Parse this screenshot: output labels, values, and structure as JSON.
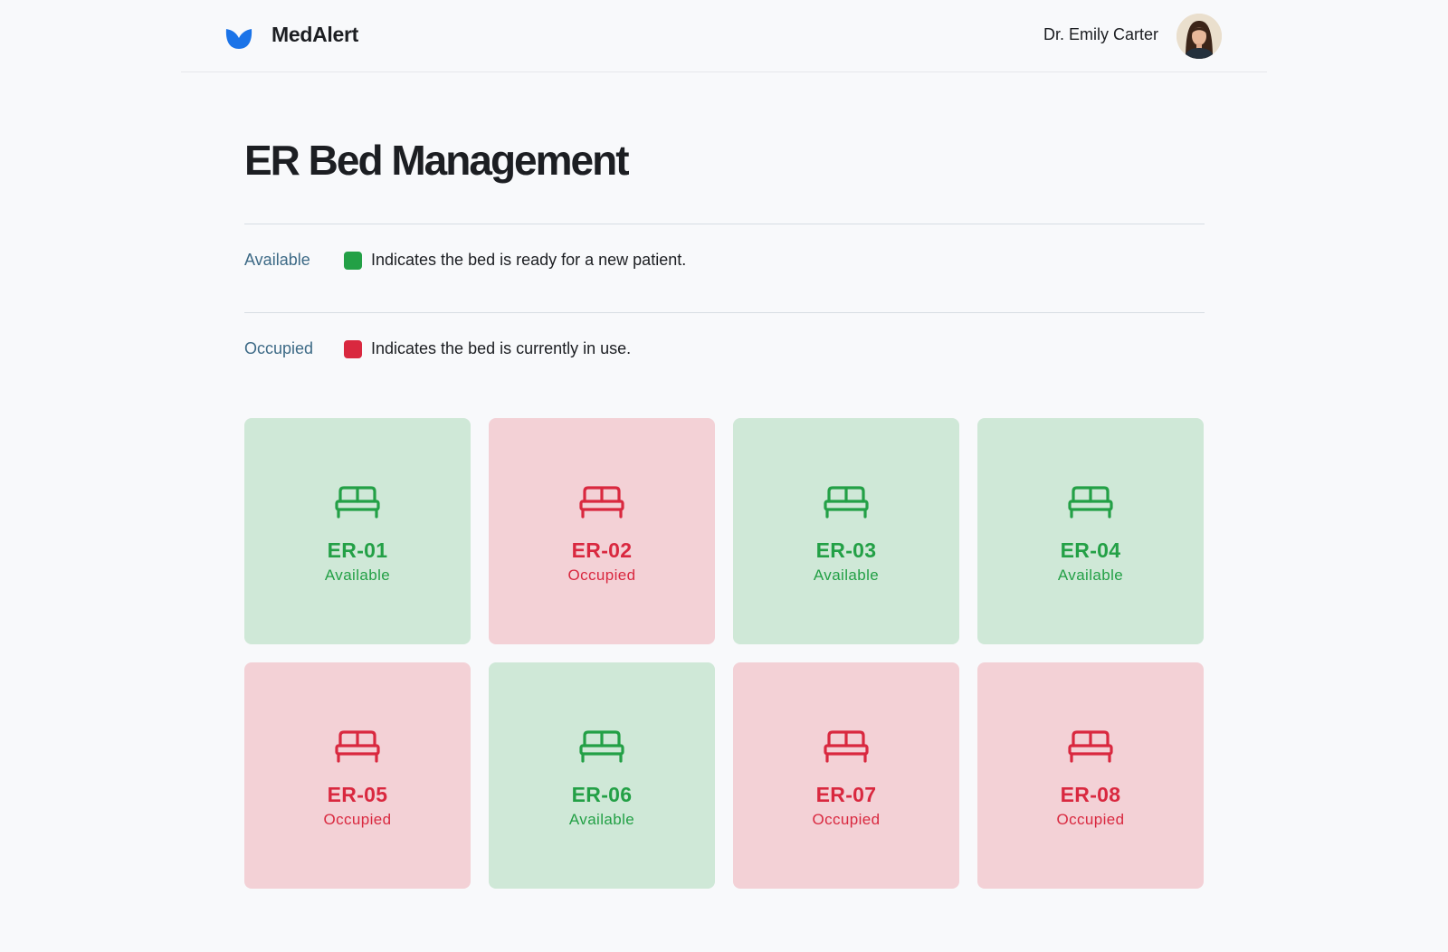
{
  "header": {
    "app_name": "MedAlert",
    "user_name": "Dr. Emily Carter",
    "logo_icon": "leaf-logo-icon",
    "brand_color": "#1a73e8"
  },
  "page": {
    "title": "ER Bed Management"
  },
  "legend": [
    {
      "term": "Available",
      "description": "Indicates the bed is ready for a new patient.",
      "color": "#23a046"
    },
    {
      "term": "Occupied",
      "description": "Indicates the bed is currently in use.",
      "color": "#d9283f"
    }
  ],
  "status_colors": {
    "available": {
      "fg": "#23a046",
      "bg": "#cfe8d7"
    },
    "occupied": {
      "fg": "#d9283f",
      "bg": "#f3d1d6"
    }
  },
  "beds": [
    {
      "id": "ER-01",
      "status": "Available",
      "icon": "bed-icon"
    },
    {
      "id": "ER-02",
      "status": "Occupied",
      "icon": "bed-icon"
    },
    {
      "id": "ER-03",
      "status": "Available",
      "icon": "bed-icon"
    },
    {
      "id": "ER-04",
      "status": "Available",
      "icon": "bed-icon"
    },
    {
      "id": "ER-05",
      "status": "Occupied",
      "icon": "bed-icon"
    },
    {
      "id": "ER-06",
      "status": "Available",
      "icon": "bed-icon"
    },
    {
      "id": "ER-07",
      "status": "Occupied",
      "icon": "bed-icon"
    },
    {
      "id": "ER-08",
      "status": "Occupied",
      "icon": "bed-icon"
    }
  ]
}
